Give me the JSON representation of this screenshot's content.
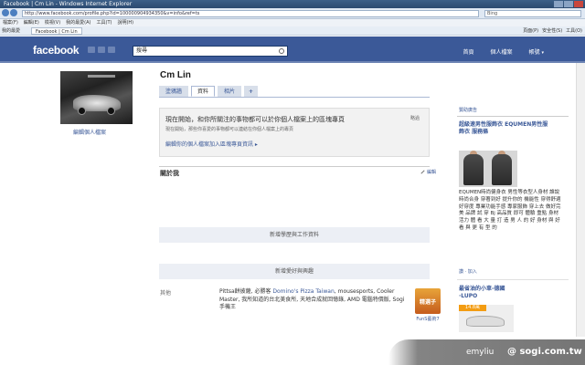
{
  "browser": {
    "title": "Facebook | Cm Lin - Windows Internet Explorer",
    "url": "http://www.facebook.com/profile.php?id=100000904934350&v=info&ref=ts",
    "search_placeholder": "Bing",
    "menu": [
      "檔案(F)",
      "編輯(E)",
      "檢視(V)",
      "我的最愛(A)",
      "工具(T)",
      "說明(H)"
    ],
    "favorites_label": "我的最愛",
    "tab_label": "Facebook | Cm Lin",
    "tools": [
      "頁面(P)",
      "安全性(S)",
      "工具(O)"
    ]
  },
  "fb": {
    "logo": "facebook",
    "search_value": "搜尋",
    "nav": [
      "首頁",
      "個人檔案",
      "帳號"
    ]
  },
  "profile": {
    "name": "Cm Lin",
    "edit_pic": "編輯個人檔案",
    "tabs": [
      {
        "label": "塗鴉牆",
        "active": false
      },
      {
        "label": "資料",
        "active": true
      },
      {
        "label": "相片",
        "active": false
      },
      {
        "label": "+",
        "active": false
      }
    ]
  },
  "notice": {
    "title": "現在開始，和你所關注的事物都可以於你個人檔案上的區塊專頁",
    "sub": "現在開始，那些你喜愛的事物都可以連結在你個人檔案上的專頁",
    "link": "編輯你的個人檔案加入區塊專頁資訊 ▸",
    "close": "略過"
  },
  "about": {
    "title": "關於我",
    "edit": "編輯",
    "add_work": "新增學歷與工作資料",
    "add_friends": "新增愛好與興趣"
  },
  "other": {
    "label": "其他",
    "text_pre": "Pittsa餅披薩, 必勝客 ",
    "link": "Domino's Pizza Taiwan",
    "text_post": ", mousesports, Cooler Master, 我所知道的台北美食所, 天地合成就回憶錄, AMD 電腦特價版, Sogi 手機王",
    "img_label": "精選子",
    "img_caption": "FunS藝術7"
  },
  "ads": {
    "header": "贊助廣告",
    "ad1_title": "超級速男性服飾衣 EQUMEN男性服飾衣 服務條",
    "ad1_body": "EQUMEN時尚健身衣 男性等衣型人身材 誰說時尚合身 穿著到好 提升你的 機能性 穿得舒適 好穿度 專業功能手感 專家服飾 穿上去 做好完美 品牌 試 穿 Bj 高品質 即可 體驗 重點 身材活力 體 看 大 量 打 造 男 人 的 好 身材 與 好 看 與 更 有 型 的",
    "ad1_like": "讚 · 加入",
    "ad2_title": "最省油的小車-德國 ·LUPO",
    "ad2_badge": "14.8萬"
  },
  "watermark": {
    "user": "emyliu",
    "site": "@ sogi.com.tw"
  },
  "colors": {
    "fb_blue": "#3b5998",
    "fb_light": "#d8dfea"
  }
}
